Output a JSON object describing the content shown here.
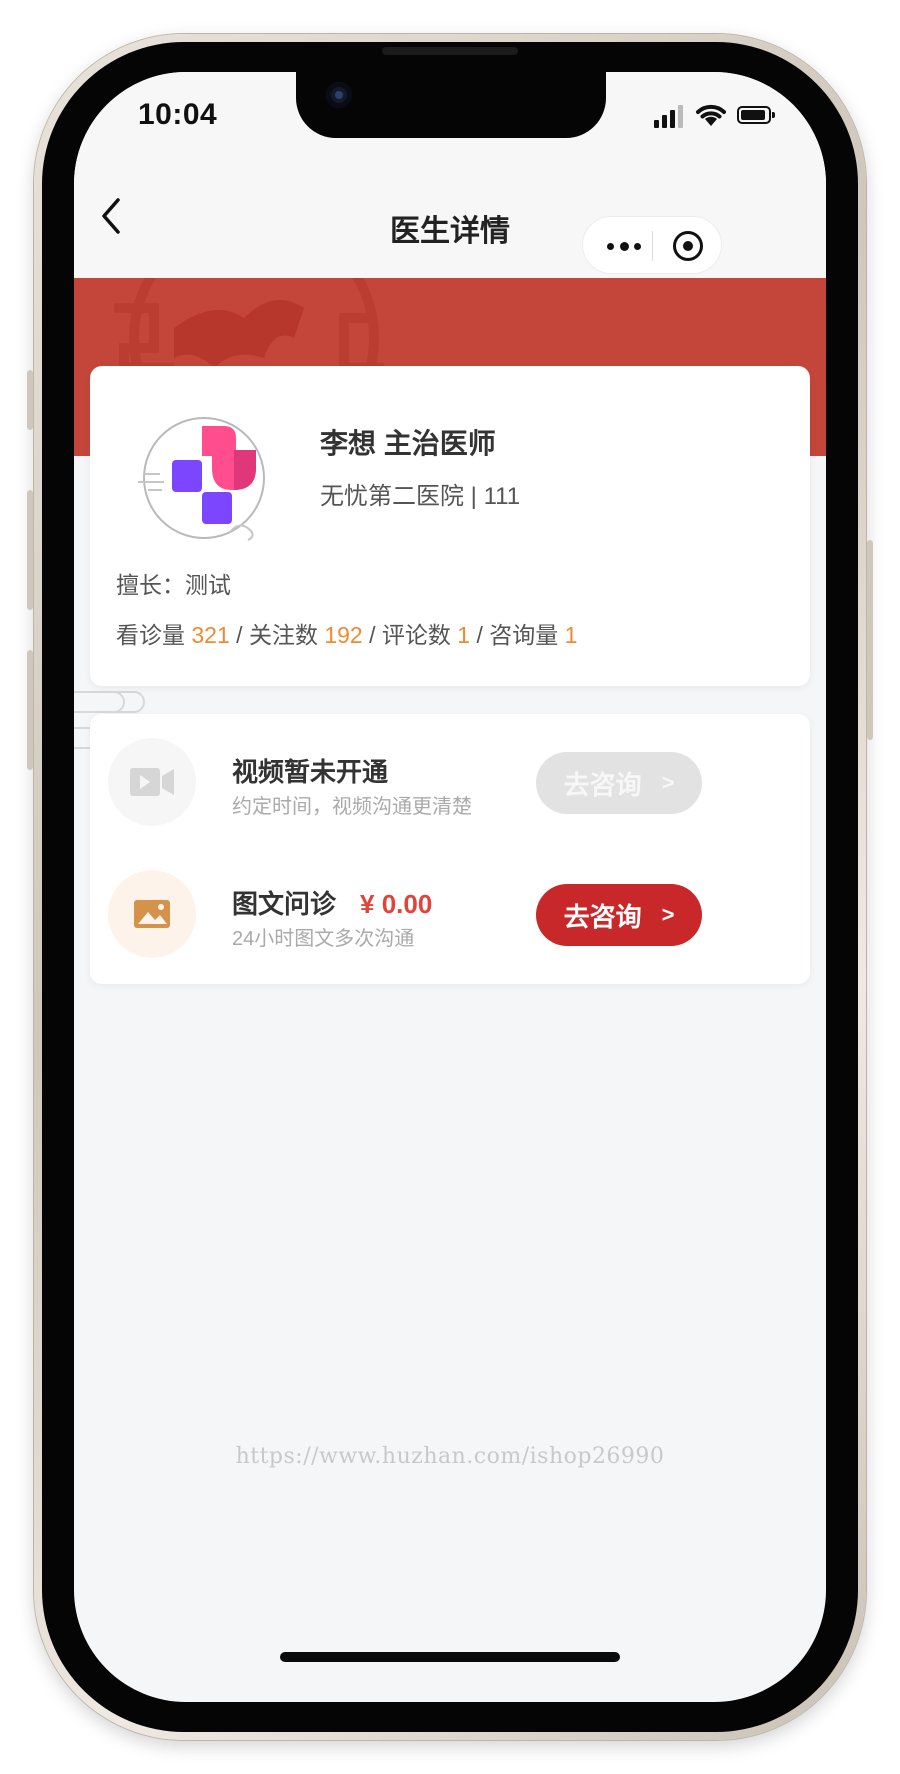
{
  "status_bar": {
    "time": "10:04"
  },
  "nav": {
    "title": "医生详情"
  },
  "doctor": {
    "name_title": "李想 主治医师",
    "hospital": "无忧第二医院 | 111",
    "specialty": "擅长：测试",
    "stats": [
      {
        "label": "看诊量",
        "value": "321"
      },
      {
        "label": "关注数",
        "value": "192"
      },
      {
        "label": "评论数",
        "value": "1"
      },
      {
        "label": "咨询量",
        "value": "1"
      }
    ],
    "separator": "/"
  },
  "services": [
    {
      "icon": "video-camera-icon",
      "title": "视频暂未开通",
      "price": "",
      "desc": "约定时间，视频沟通更清楚",
      "button": "去咨询",
      "enabled": false
    },
    {
      "icon": "image-icon",
      "title": "图文问诊",
      "price": "¥ 0.00",
      "desc": "24小时图文多次沟通",
      "button": "去咨询",
      "enabled": true
    }
  ],
  "button_arrow": ">",
  "watermark": "https://www.huzhan.com/ishop26990",
  "colors": {
    "banner": "#c4463b",
    "accent": "#c8282a",
    "stat_number": "#f08a30",
    "price": "#e0443a"
  }
}
